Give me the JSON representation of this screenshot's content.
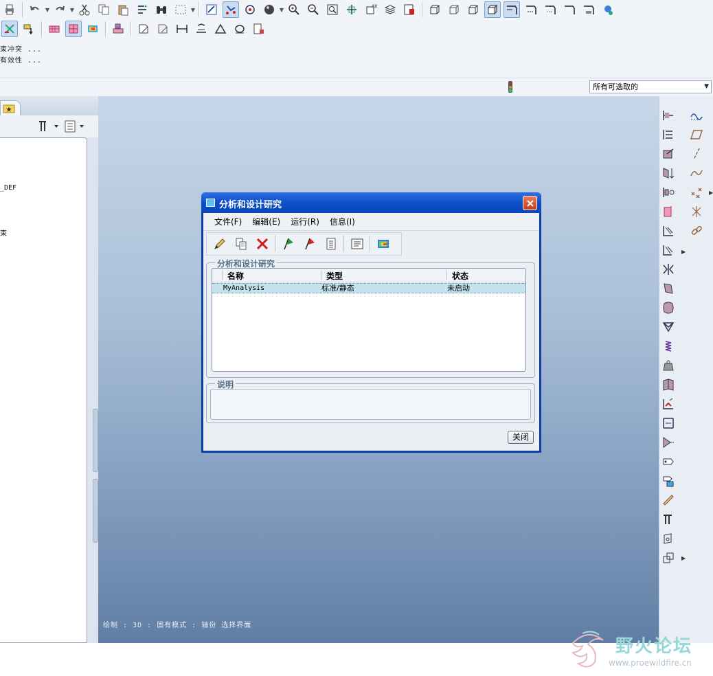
{
  "messages": {
    "line1": "束冲突 ...",
    "line2": "有效性 ..."
  },
  "filter": {
    "selected": "所有可选取的"
  },
  "navigator": {
    "tree_items": [
      "_DEF",
      "束"
    ]
  },
  "graphics_status": "绘制 : 3D : 固有模式 : 轴份 选择界面",
  "dialog": {
    "title": "分析和设计研究",
    "menus": [
      "文件(F)",
      "编辑(E)",
      "运行(R)",
      "信息(I)"
    ],
    "studies_group_label": "分析和设计研究",
    "columns": [
      "名称",
      "类型",
      "状态"
    ],
    "rows": [
      {
        "name": "MyAnalysis",
        "type": "标准/静态",
        "status": "未启动"
      }
    ],
    "description_label": "说明",
    "close_label": "关闭"
  },
  "watermark": {
    "name": "野火论坛",
    "url": "www.proewildfire.cn"
  },
  "colors": {
    "dialog_frame": "#0b3ea8",
    "graphics_top": "#c7d7e9",
    "graphics_bottom": "#607ea4",
    "selected_row": "#c4e3ec"
  }
}
